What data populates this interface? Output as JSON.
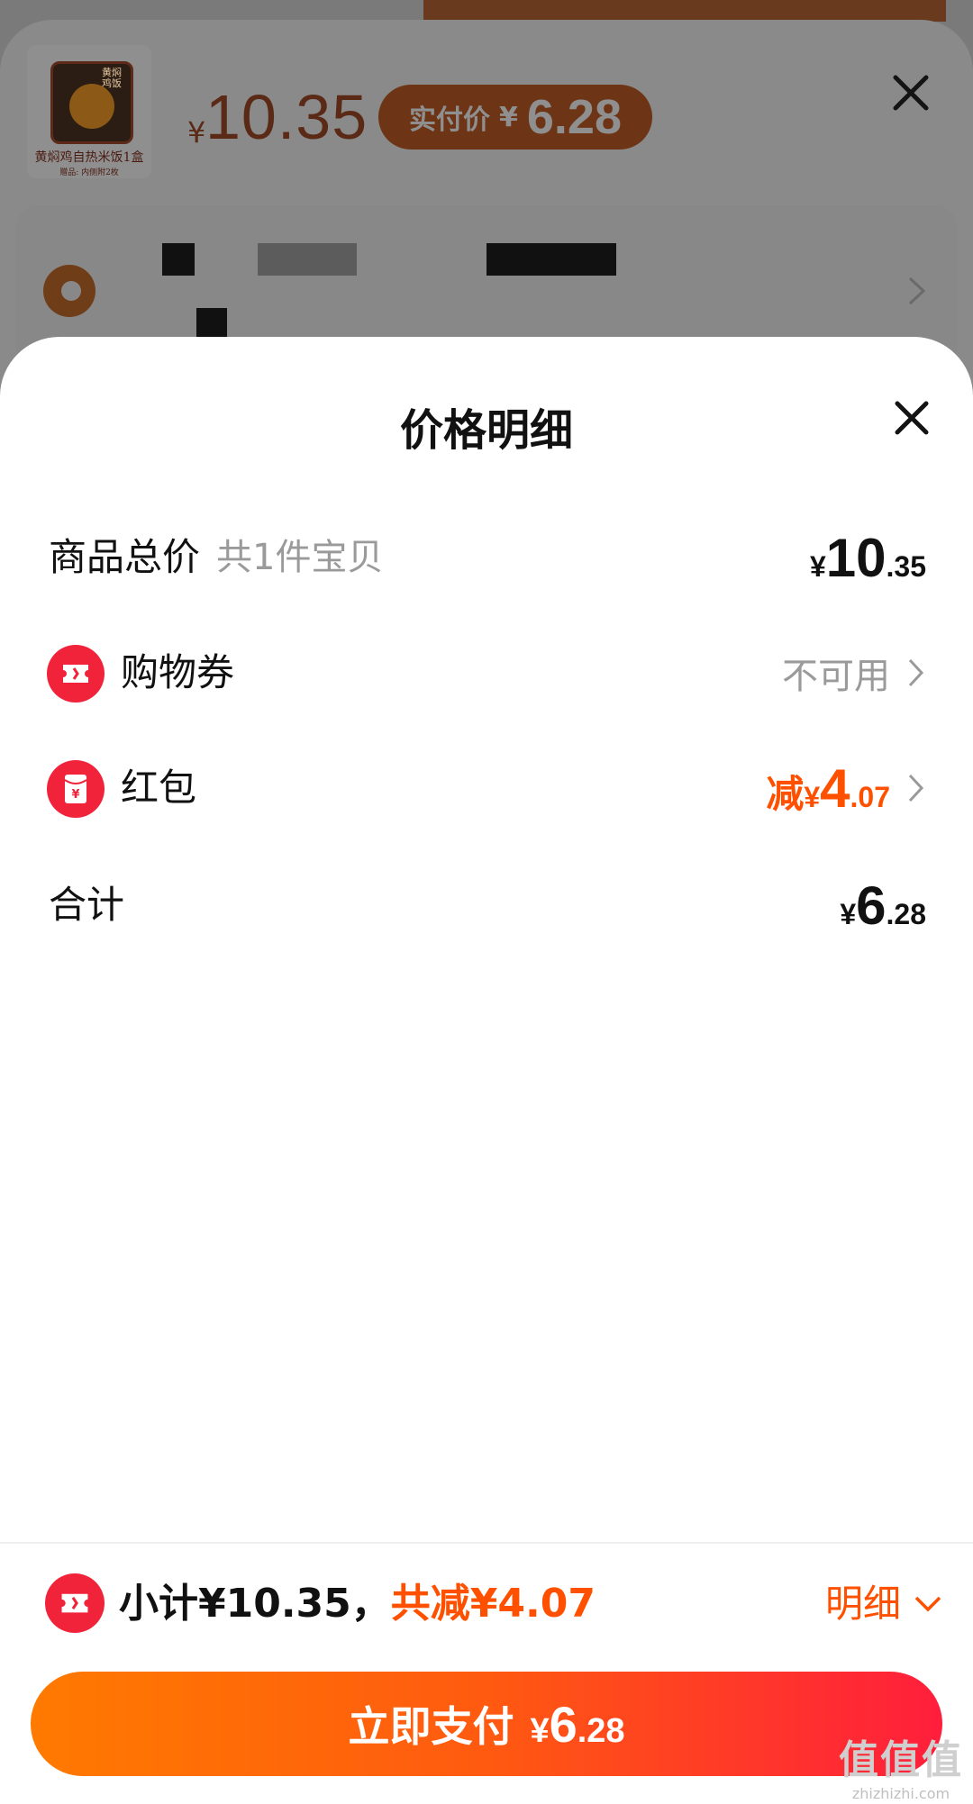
{
  "background": {
    "product_title": "黄焖鸡自热米饭1盒",
    "product_gift": "赠品: 内侧附2枚",
    "product_logo_text": "黄焖鸡饭",
    "price_symbol": "¥",
    "price": "10.35",
    "pay_pill_label": "实付价",
    "pay_pill_symbol": "¥",
    "pay_pill_amount": "6.28"
  },
  "sheet": {
    "title": "价格明细",
    "rows": [
      {
        "label": "商品总价",
        "sub": "共1件宝贝",
        "yen": "¥",
        "int": "10",
        "dec": ".35"
      },
      {
        "label": "购物券",
        "value": "不可用"
      },
      {
        "label": "红包",
        "prefix": "减",
        "yen": "¥",
        "int": "4",
        "dec": ".07"
      },
      {
        "label": "合计",
        "yen": "¥",
        "int": "6",
        "dec": ".28"
      }
    ]
  },
  "footer": {
    "subtotal_text": "小计¥10.35，",
    "discount_text": "共减¥4.07",
    "detail_label": "明细",
    "pay_label": "立即支付",
    "pay_yen": "¥",
    "pay_int": "6",
    "pay_dec": ".28"
  },
  "watermark": {
    "main": "值值值",
    "sub": "zhizhizhi.com"
  },
  "colors": {
    "accent": "#ff5000",
    "red": "#f0233a",
    "text": "#111111",
    "muted": "#9a9a9a"
  },
  "icons": [
    "close-icon",
    "coupon-ticket-icon",
    "red-envelope-icon",
    "chevron-right-icon",
    "chevron-down-icon"
  ]
}
